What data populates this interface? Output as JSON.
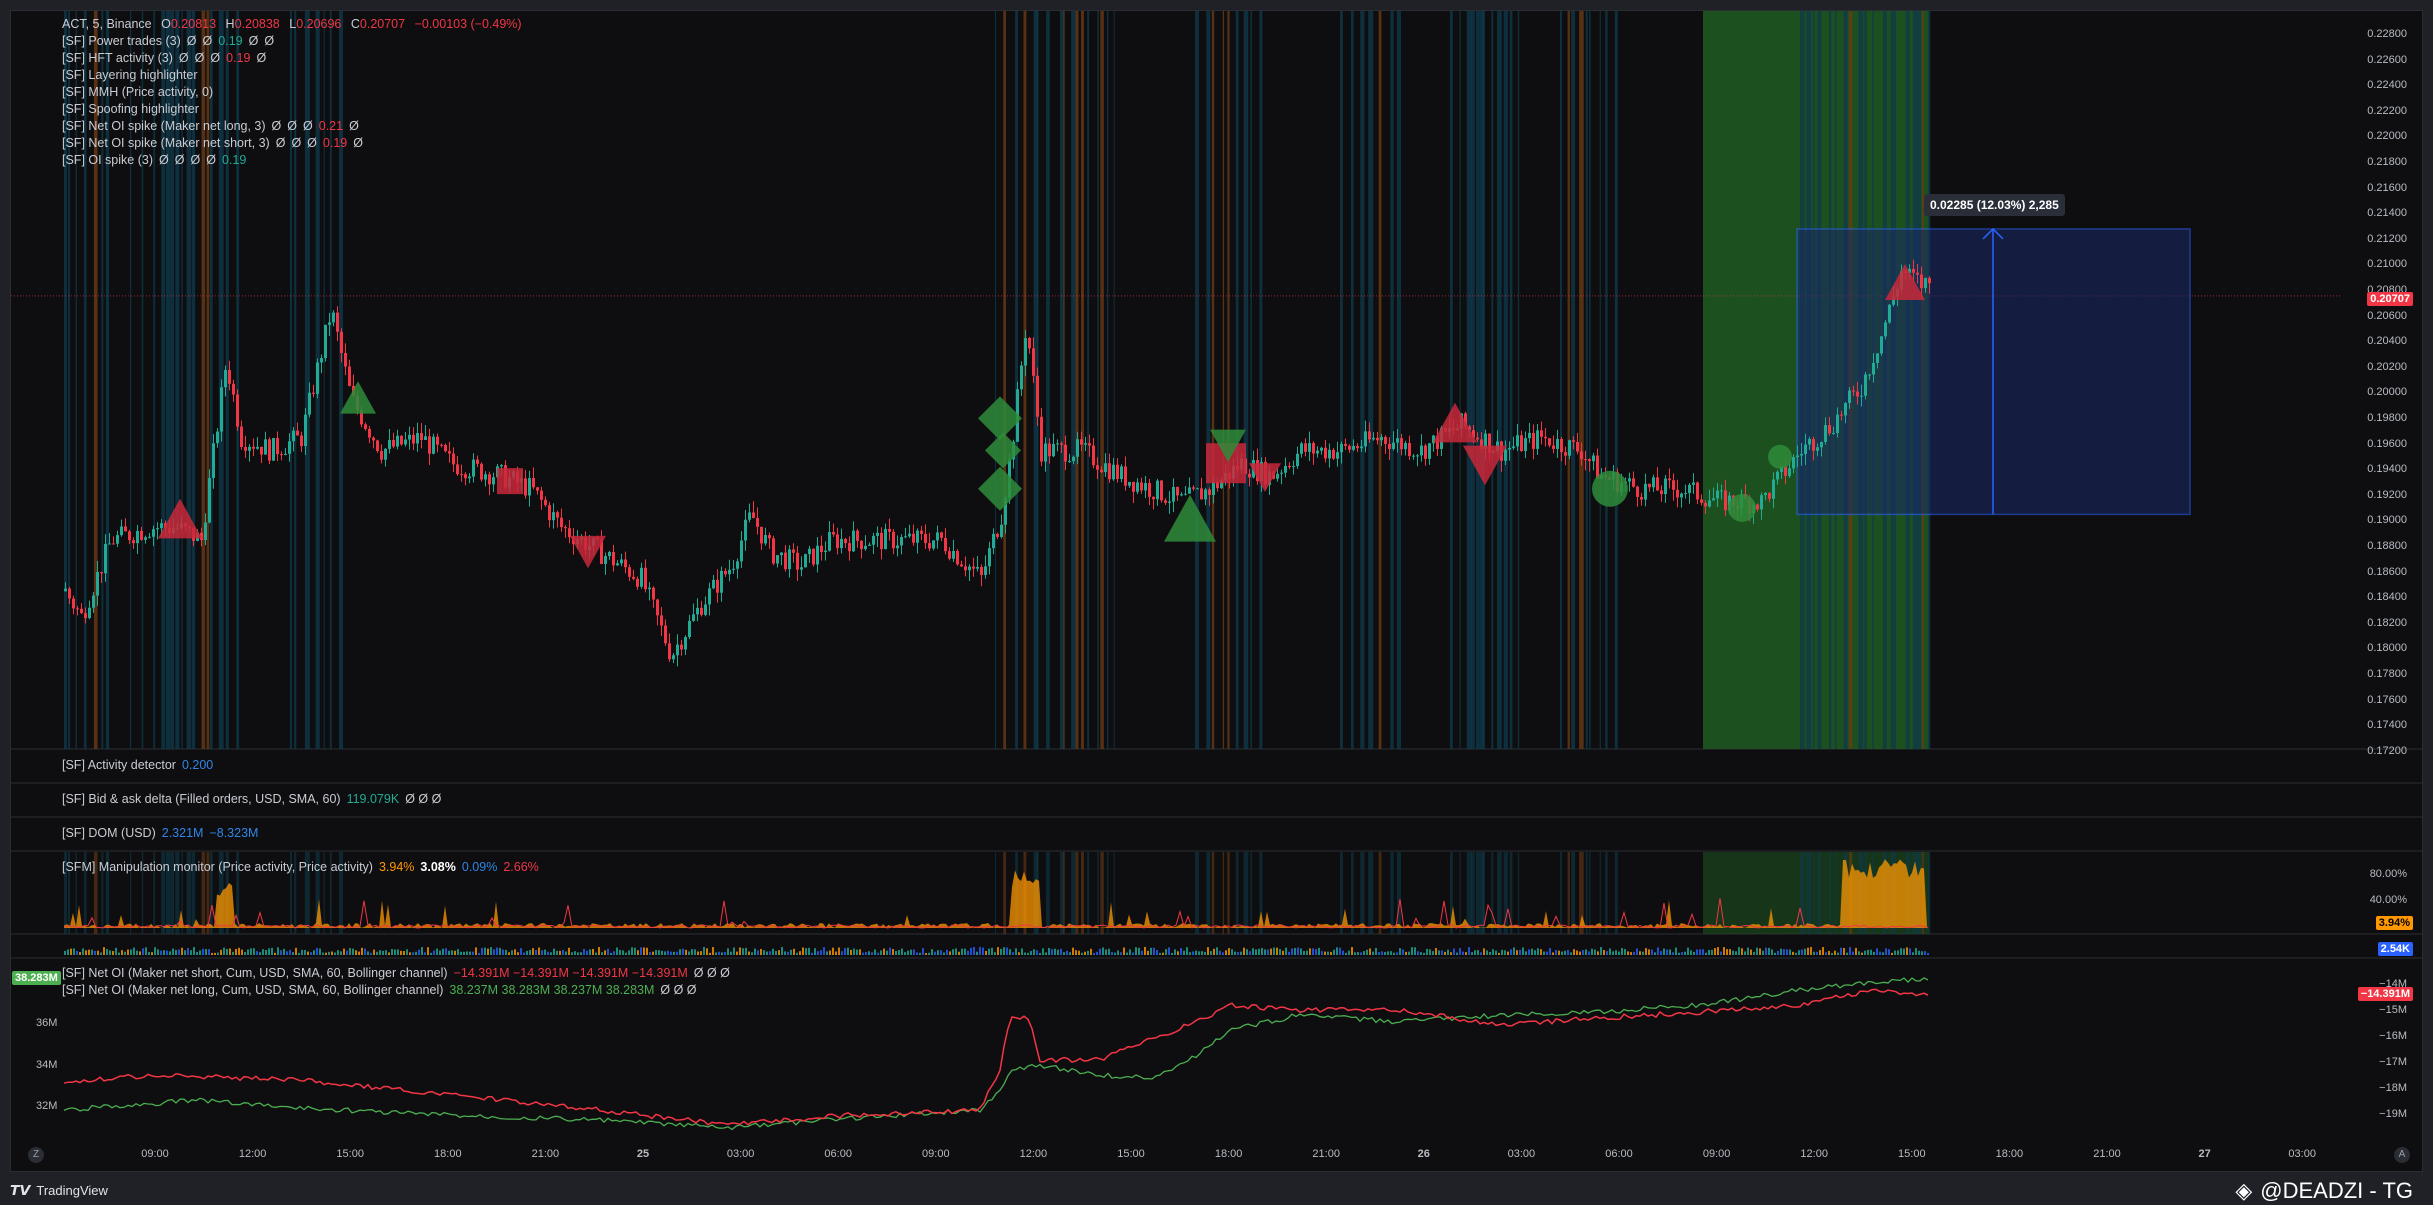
{
  "colors": {
    "up": "#22ab94",
    "down": "#f23645",
    "bg": "#0e0e10",
    "accent_blue": "#2962ff",
    "green_zone": "#1e5c22"
  },
  "main_legend": {
    "title": "ACT, 5, Binance",
    "o_label": "O",
    "o_val": "0.20813",
    "h_label": "H",
    "h_val": "0.20838",
    "l_label": "L",
    "l_val": "0.20696",
    "c_label": "C",
    "c_val": "0.20707",
    "chg": "−0.00103 (−0.49%)",
    "rows": [
      {
        "name": "[SF] Power trades (3)",
        "vals": [
          "Ø",
          "Ø",
          "0.19",
          "Ø",
          "Ø"
        ]
      },
      {
        "name": "[SF] HFT activity (3)",
        "vals": [
          "Ø",
          "Ø",
          "Ø",
          "0.19",
          "Ø"
        ]
      },
      {
        "name": "[SF] Layering highlighter",
        "vals": []
      },
      {
        "name": "[SF] MMH (Price activity, 0)",
        "vals": []
      },
      {
        "name": "[SF] Spoofing highlighter",
        "vals": []
      },
      {
        "name": "[SF] Net OI spike (Maker net long, 3)",
        "vals": [
          "Ø",
          "Ø",
          "Ø",
          "0.21",
          "Ø"
        ]
      },
      {
        "name": "[SF] Net OI spike (Maker net short, 3)",
        "vals": [
          "Ø",
          "Ø",
          "Ø",
          "0.19",
          "Ø"
        ]
      },
      {
        "name": "[SF] OI spike (3)",
        "vals": [
          "Ø",
          "Ø",
          "Ø",
          "Ø",
          "0.19"
        ]
      }
    ]
  },
  "price_axis": [
    "0.22800",
    "0.22600",
    "0.22400",
    "0.22200",
    "0.22000",
    "0.21800",
    "0.21600",
    "0.21400",
    "0.21200",
    "0.21000",
    "0.20800",
    "0.20600",
    "0.20400",
    "0.20200",
    "0.20000",
    "0.19800",
    "0.19600",
    "0.19400",
    "0.19200",
    "0.19000",
    "0.18800",
    "0.18600",
    "0.18400",
    "0.18200",
    "0.18000",
    "0.17800",
    "0.17600",
    "0.17400",
    "0.17200"
  ],
  "last_price": "0.20707",
  "measure_label": "0.02285 (12.03%) 2,285",
  "panes": {
    "activity": {
      "name": "[SF] Activity detector",
      "val": "0.200"
    },
    "bidask": {
      "name": "[SF] Bid & ask delta (Filled orders, USD, SMA, 60)",
      "val": "119.079K",
      "rest": "Ø  Ø  Ø"
    },
    "dom": {
      "name": "[SF] DOM (USD)",
      "v1": "2.321M",
      "v2": "−8.323M"
    },
    "manip": {
      "name": "[SFM] Manipulation monitor (Price activity, Price activity)",
      "v1": "3.94%",
      "v2": "3.08%",
      "v3": "0.09%",
      "v4": "2.66%",
      "axis": [
        "80.00%",
        "40.00%"
      ],
      "badge1": "3.94%",
      "badge2": "2.54K"
    },
    "netoi": {
      "short_name": "[SF] Net OI (Maker net short, Cum, USD, SMA, 60, Bollinger channel)",
      "short_vals": "−14.391M  −14.391M  −14.391M  −14.391M",
      "long_name": "[SF] Net OI (Maker net long, Cum, USD, SMA, 60, Bollinger channel)",
      "long_vals": "38.237M  38.283M  38.237M  38.283M",
      "rest": "Ø  Ø  Ø",
      "left_badge": "38.283M",
      "left_axis": [
        "36M",
        "34M",
        "32M"
      ],
      "right_axis": [
        "−14M",
        "−15M",
        "−16M",
        "−17M",
        "−18M",
        "−19M"
      ],
      "right_badge": "−14.391M"
    }
  },
  "time_axis": [
    "09:00",
    "12:00",
    "15:00",
    "18:00",
    "21:00",
    "25",
    "03:00",
    "06:00",
    "09:00",
    "12:00",
    "15:00",
    "18:00",
    "21:00",
    "26",
    "03:00",
    "06:00",
    "09:00",
    "12:00",
    "15:00",
    "18:00",
    "21:00",
    "27",
    "03:00"
  ],
  "footer": {
    "brand": "TradingView",
    "watermark": "@DEADZI - TG"
  },
  "buttons": {
    "z": "Z",
    "a": "A"
  }
}
